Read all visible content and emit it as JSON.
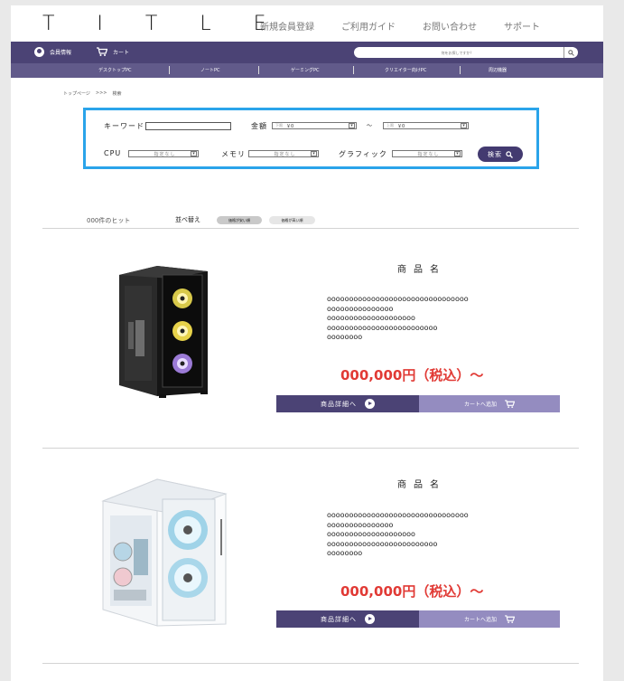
{
  "header": {
    "logo": "T I T L E",
    "nav": [
      "新規会員登録",
      "ご利用ガイド",
      "お問い合わせ",
      "サポート"
    ]
  },
  "utility": {
    "member_label": "会員情報",
    "cart_label": "カート",
    "search_placeholder": "何をお探しですか？"
  },
  "categories": [
    "デスクトップPC",
    "ノートPC",
    "ゲーミングPC",
    "クリエイター向けPC",
    "周辺機器"
  ],
  "breadcrumb": {
    "home": "トップページ",
    "sep": ">>>",
    "current": "検索"
  },
  "search_panel": {
    "keyword_label": "キーワード",
    "keyword_value": "",
    "price_label": "金額",
    "price_min_caption": "下限",
    "price_min_value": "￥0",
    "range_sep": "～",
    "price_max_caption": "上限",
    "price_max_value": "￥0",
    "cpu_label": "CPU",
    "cpu_value": "指定なし",
    "memory_label": "メモリ",
    "memory_value": "指定なし",
    "graphic_label": "グラフィック",
    "graphic_value": "指定なし",
    "search_button": "検索"
  },
  "results": {
    "count_text": "000件のヒット",
    "sort_label": "並べ替え",
    "sort_options": [
      "価格が安い順",
      "価格が高い順"
    ]
  },
  "products": [
    {
      "name": "商品名",
      "description": [
        "oooooooooooooooooooooooooooooooo",
        "ooooooooooooooo",
        "oooooooooooooooooooo",
        "ooooooooooooooooooooooooo",
        "oooooooo"
      ],
      "price": "000,000円（税込）～",
      "detail_button": "商品詳細へ",
      "cart_button": "カートへ追加"
    },
    {
      "name": "商品名",
      "description": [
        "oooooooooooooooooooooooooooooooo",
        "ooooooooooooooo",
        "oooooooooooooooooooo",
        "ooooooooooooooooooooooooo",
        "oooooooo"
      ],
      "price": "000,000円（税込）～",
      "detail_button": "商品詳細へ",
      "cart_button": "カートへ追加"
    }
  ],
  "colors": {
    "brand": "#4b4375",
    "category_bar": "#615a8a",
    "cart_button": "#948cc0",
    "price": "#e13a35",
    "search_border": "#2aa4ea"
  }
}
